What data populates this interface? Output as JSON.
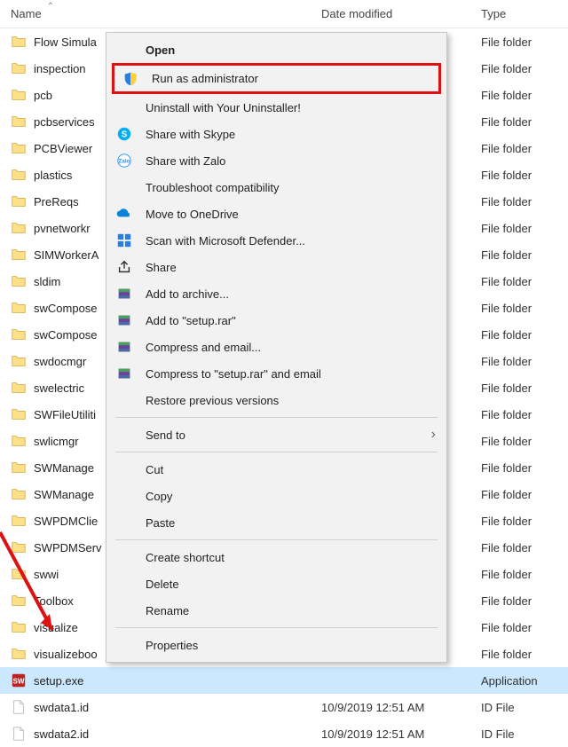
{
  "columns": {
    "name": "Name",
    "date": "Date modified",
    "type": "Type"
  },
  "rows": [
    {
      "kind": "folder",
      "name": "Flow Simula",
      "date": "",
      "type": "File folder"
    },
    {
      "kind": "folder",
      "name": "inspection",
      "date": "",
      "type": "File folder"
    },
    {
      "kind": "folder",
      "name": "pcb",
      "date": "",
      "type": "File folder"
    },
    {
      "kind": "folder",
      "name": "pcbservices",
      "date": "",
      "type": "File folder"
    },
    {
      "kind": "folder",
      "name": "PCBViewer",
      "date": "",
      "type": "File folder"
    },
    {
      "kind": "folder",
      "name": "plastics",
      "date": "",
      "type": "File folder"
    },
    {
      "kind": "folder",
      "name": "PreReqs",
      "date": "",
      "type": "File folder"
    },
    {
      "kind": "folder",
      "name": "pvnetworkr",
      "date": "",
      "type": "File folder"
    },
    {
      "kind": "folder",
      "name": "SIMWorkerA",
      "date": "",
      "type": "File folder"
    },
    {
      "kind": "folder",
      "name": "sldim",
      "date": "",
      "type": "File folder"
    },
    {
      "kind": "folder",
      "name": "swCompose",
      "date": "",
      "type": "File folder"
    },
    {
      "kind": "folder",
      "name": "swCompose",
      "date": "",
      "type": "File folder"
    },
    {
      "kind": "folder",
      "name": "swdocmgr",
      "date": "",
      "type": "File folder"
    },
    {
      "kind": "folder",
      "name": "swelectric",
      "date": "",
      "type": "File folder"
    },
    {
      "kind": "folder",
      "name": "SWFileUtiliti",
      "date": "",
      "type": "File folder"
    },
    {
      "kind": "folder",
      "name": "swlicmgr",
      "date": "",
      "type": "File folder"
    },
    {
      "kind": "folder",
      "name": "SWManage",
      "date": "",
      "type": "File folder"
    },
    {
      "kind": "folder",
      "name": "SWManage",
      "date": "",
      "type": "File folder"
    },
    {
      "kind": "folder",
      "name": "SWPDMClie",
      "date": "",
      "type": "File folder"
    },
    {
      "kind": "folder",
      "name": "SWPDMServ",
      "date": "",
      "type": "File folder"
    },
    {
      "kind": "folder",
      "name": "swwi",
      "date": "",
      "type": "File folder"
    },
    {
      "kind": "folder",
      "name": "Toolbox",
      "date": "",
      "type": "File folder"
    },
    {
      "kind": "folder",
      "name": "visualize",
      "date": "",
      "type": "File folder"
    },
    {
      "kind": "folder",
      "name": "visualizeboo",
      "date": "",
      "type": "File folder"
    },
    {
      "kind": "exe",
      "name": "setup.exe",
      "date": "",
      "type": "Application",
      "selected": true
    },
    {
      "kind": "file",
      "name": "swdata1.id",
      "date": "10/9/2019 12:51 AM",
      "type": "ID File"
    },
    {
      "kind": "file",
      "name": "swdata2.id",
      "date": "10/9/2019 12:51 AM",
      "type": "ID File"
    }
  ],
  "context_menu": {
    "groups": [
      [
        {
          "label": "Open",
          "bold": true
        },
        {
          "label": "Run as administrator",
          "icon": "shield",
          "highlight": true
        },
        {
          "label": "Uninstall with Your Uninstaller!"
        },
        {
          "label": "Share with Skype",
          "icon": "skype"
        },
        {
          "label": "Share with Zalo",
          "icon": "zalo"
        },
        {
          "label": "Troubleshoot compatibility"
        },
        {
          "label": "Move to OneDrive",
          "icon": "onedrive"
        },
        {
          "label": "Scan with Microsoft Defender...",
          "icon": "defender"
        },
        {
          "label": "Share",
          "icon": "share"
        },
        {
          "label": "Add to archive...",
          "icon": "winrar"
        },
        {
          "label": "Add to \"setup.rar\"",
          "icon": "winrar"
        },
        {
          "label": "Compress and email...",
          "icon": "winrar"
        },
        {
          "label": "Compress to \"setup.rar\" and email",
          "icon": "winrar"
        },
        {
          "label": "Restore previous versions"
        }
      ],
      [
        {
          "label": "Send to",
          "submenu": true
        }
      ],
      [
        {
          "label": "Cut"
        },
        {
          "label": "Copy"
        },
        {
          "label": "Paste"
        }
      ],
      [
        {
          "label": "Create shortcut"
        },
        {
          "label": "Delete"
        },
        {
          "label": "Rename"
        }
      ],
      [
        {
          "label": "Properties"
        }
      ]
    ]
  }
}
